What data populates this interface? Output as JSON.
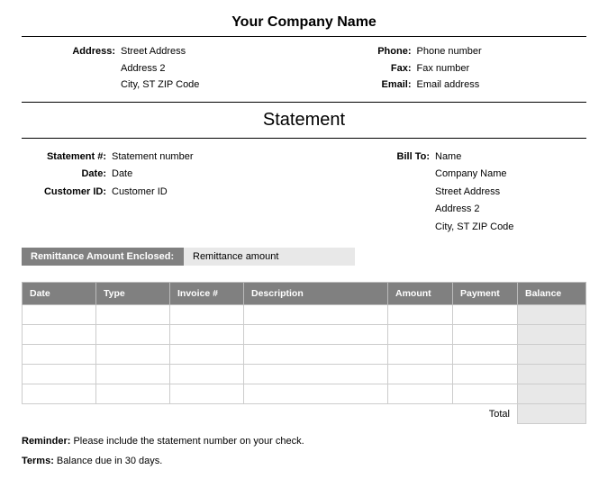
{
  "company": {
    "name": "Your Company Name",
    "address_label": "Address:",
    "address_line1": "Street Address",
    "address_line2": "Address 2",
    "address_line3": "City, ST  ZIP Code",
    "phone_label": "Phone:",
    "phone": "Phone number",
    "fax_label": "Fax:",
    "fax": "Fax number",
    "email_label": "Email:",
    "email": "Email address"
  },
  "title": "Statement",
  "meta": {
    "statement_num_label": "Statement #:",
    "statement_num": "Statement number",
    "date_label": "Date:",
    "date": "Date",
    "customer_id_label": "Customer ID:",
    "customer_id": "Customer ID"
  },
  "bill_to": {
    "label": "Bill To:",
    "name": "Name",
    "company": "Company Name",
    "address1": "Street Address",
    "address2": "Address 2",
    "address3": "City, ST  ZIP Code"
  },
  "remittance": {
    "label": "Remittance Amount Enclosed:",
    "value": "Remittance amount"
  },
  "table": {
    "headers": {
      "date": "Date",
      "type": "Type",
      "invoice": "Invoice #",
      "description": "Description",
      "amount": "Amount",
      "payment": "Payment",
      "balance": "Balance"
    },
    "total_label": "Total"
  },
  "footer": {
    "reminder_label": "Reminder:",
    "reminder_text": " Please include the statement number on your check.",
    "terms_label": "Terms:",
    "terms_text": " Balance due in 30 days."
  }
}
